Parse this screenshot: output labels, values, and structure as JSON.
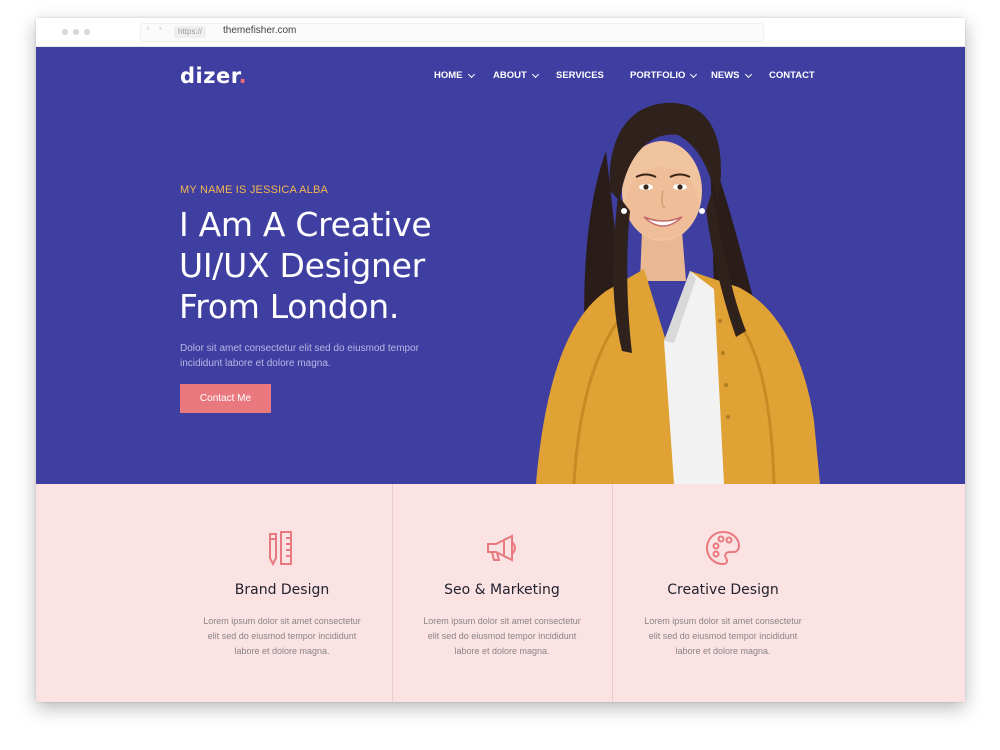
{
  "browser": {
    "protocol": "https://",
    "domain": "themefisher.com"
  },
  "site": {
    "logo": "dizer",
    "logo_dot": ".",
    "nav": [
      {
        "label": "HOME",
        "dropdown": true
      },
      {
        "label": "ABOUT",
        "dropdown": true
      },
      {
        "label": "SERVICES",
        "dropdown": false
      },
      {
        "label": "PORTFOLIO",
        "dropdown": true
      },
      {
        "label": "NEWS",
        "dropdown": true
      },
      {
        "label": "CONTACT",
        "dropdown": false
      }
    ]
  },
  "hero": {
    "eyebrow": "MY NAME IS JESSICA ALBA",
    "headline_line1": "I Am A Creative",
    "headline_line2": "UI/UX Designer",
    "headline_line3": "From London.",
    "lead": "Dolor sit amet consectetur elit sed do eiusmod tempor incididunt labore et dolore magna.",
    "cta_label": "Contact Me"
  },
  "services": [
    {
      "icon": "pencil-ruler-icon",
      "title": "Brand Design",
      "text": "Lorem ipsum dolor sit amet consectetur elit sed do eiusmod tempor incididunt labore et dolore magna."
    },
    {
      "icon": "megaphone-icon",
      "title": "Seo & Marketing",
      "text": "Lorem ipsum dolor sit amet consectetur elit sed do eiusmod tempor incididunt labore et dolore magna."
    },
    {
      "icon": "palette-icon",
      "title": "Creative Design",
      "text": "Lorem ipsum dolor sit amet consectetur elit sed do eiusmod tempor incididunt labore et dolore magna."
    }
  ],
  "colors": {
    "hero_bg": "#3f3ea1",
    "accent": "#e9787f",
    "eyebrow": "#f5b84f",
    "services_bg": "#fbe3e3"
  }
}
